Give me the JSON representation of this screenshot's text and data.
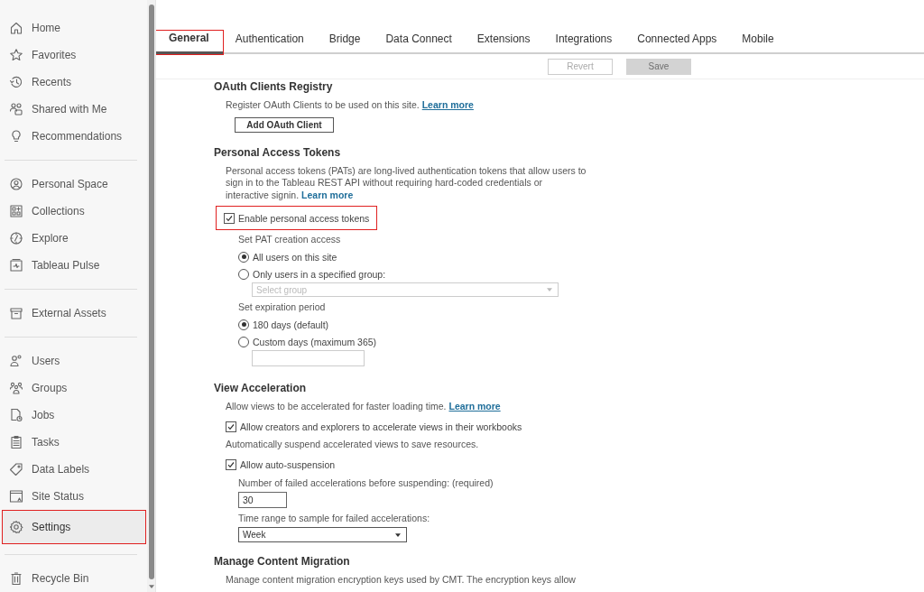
{
  "sidebar": {
    "groups": [
      {
        "items": [
          {
            "label": "Home",
            "selected": false,
            "highlighted": false
          },
          {
            "label": "Favorites",
            "selected": false,
            "highlighted": false
          },
          {
            "label": "Recents",
            "selected": false,
            "highlighted": false
          },
          {
            "label": "Shared with Me",
            "selected": false,
            "highlighted": false
          },
          {
            "label": "Recommendations",
            "selected": false,
            "highlighted": false
          }
        ]
      },
      {
        "items": [
          {
            "label": "Personal Space",
            "selected": false,
            "highlighted": false
          },
          {
            "label": "Collections",
            "selected": false,
            "highlighted": false
          },
          {
            "label": "Explore",
            "selected": false,
            "highlighted": false
          },
          {
            "label": "Tableau Pulse",
            "selected": false,
            "highlighted": false
          }
        ]
      },
      {
        "items": [
          {
            "label": "External Assets",
            "selected": false,
            "highlighted": false
          }
        ]
      },
      {
        "items": [
          {
            "label": "Users",
            "selected": false,
            "highlighted": false
          },
          {
            "label": "Groups",
            "selected": false,
            "highlighted": false
          },
          {
            "label": "Jobs",
            "selected": false,
            "highlighted": false
          },
          {
            "label": "Tasks",
            "selected": false,
            "highlighted": false
          },
          {
            "label": "Data Labels",
            "selected": false,
            "highlighted": false
          },
          {
            "label": "Site Status",
            "selected": false,
            "highlighted": false
          },
          {
            "label": "Settings",
            "selected": true,
            "highlighted": true
          }
        ]
      },
      {
        "items": [
          {
            "label": "Recycle Bin",
            "selected": false,
            "highlighted": false
          }
        ]
      }
    ]
  },
  "tabs": [
    {
      "label": "General",
      "selected": true,
      "highlighted": true
    },
    {
      "label": "Authentication",
      "selected": false,
      "highlighted": false
    },
    {
      "label": "Bridge",
      "selected": false,
      "highlighted": false
    },
    {
      "label": "Data Connect",
      "selected": false,
      "highlighted": false
    },
    {
      "label": "Extensions",
      "selected": false,
      "highlighted": false
    },
    {
      "label": "Integrations",
      "selected": false,
      "highlighted": false
    },
    {
      "label": "Connected Apps",
      "selected": false,
      "highlighted": false
    },
    {
      "label": "Mobile",
      "selected": false,
      "highlighted": false
    }
  ],
  "actions": [
    {
      "label": "Revert",
      "kind": "secondary",
      "disabled": true
    },
    {
      "label": "Save",
      "kind": "primary",
      "disabled": true
    }
  ],
  "sections": [
    {
      "title": "OAuth Clients Registry",
      "blocks": [
        {
          "kind": "text",
          "text": "Register OAuth Clients to be used on this site.",
          "link": "Learn more",
          "link_underlined": true
        },
        {
          "kind": "button",
          "label": "Add OAuth Client"
        }
      ]
    },
    {
      "title": "Personal Access Tokens",
      "blocks": [
        {
          "kind": "text",
          "text": "Personal access tokens (PATs) are long-lived authentication tokens that allow users to sign in to the Tableau REST API without requiring hard-coded credentials or interactive signin.",
          "link": "Learn more",
          "link_underlined": false
        },
        {
          "kind": "checkbox",
          "label": "Enable personal access tokens",
          "checked": true,
          "highlighted": true,
          "children": [
            {
              "kind": "label",
              "text": "Set PAT creation access"
            },
            {
              "kind": "radio",
              "label": "All users on this site",
              "selected": true
            },
            {
              "kind": "radio",
              "label": "Only users in a specified group:",
              "selected": false,
              "children": [
                {
                  "kind": "select",
                  "placeholder": "Select group",
                  "disabled": true
                }
              ]
            },
            {
              "kind": "label",
              "text": "Set expiration period"
            },
            {
              "kind": "radio",
              "label": "180 days (default)",
              "selected": true
            },
            {
              "kind": "radio",
              "label": "Custom days (maximum 365)",
              "selected": false,
              "children": [
                {
                  "kind": "input"
                }
              ]
            }
          ]
        }
      ]
    },
    {
      "title": "View Acceleration",
      "blocks": [
        {
          "kind": "text",
          "text": "Allow views to be accelerated for faster loading time.",
          "link": "Learn more",
          "link_underlined": true
        },
        {
          "kind": "checkbox",
          "label": "Allow creators and explorers to accelerate views in their workbooks",
          "checked": true
        },
        {
          "kind": "text",
          "text": "Automatically suspend accelerated views to save resources."
        },
        {
          "kind": "checkbox",
          "label": "Allow auto-suspension",
          "checked": true,
          "children": [
            {
              "kind": "label",
              "text": "Number of failed accelerations before suspending: (required)"
            },
            {
              "kind": "input",
              "value": "30"
            },
            {
              "kind": "label",
              "text": "Time range to sample for failed accelerations:"
            },
            {
              "kind": "select",
              "value": "Week",
              "disabled": false
            }
          ]
        }
      ]
    },
    {
      "title": "Manage Content Migration",
      "blocks": [
        {
          "kind": "text",
          "text": "Manage content migration encryption keys used by CMT. The encryption keys allow"
        }
      ]
    }
  ]
}
